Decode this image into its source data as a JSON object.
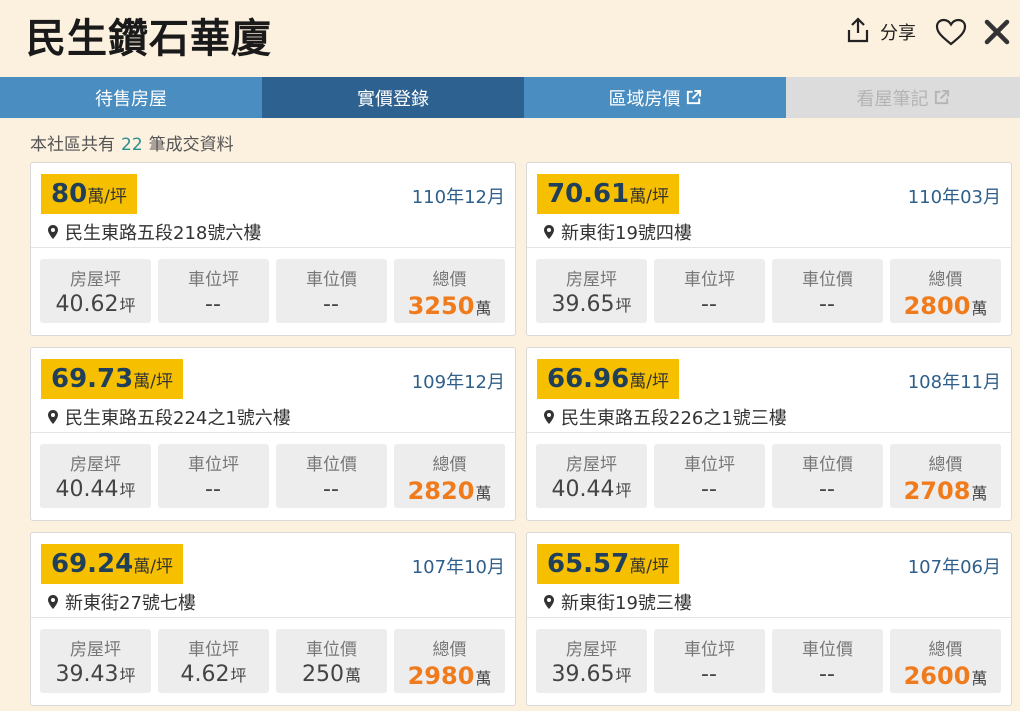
{
  "header": {
    "title": "民生鑽石華廈",
    "share_label": "分享"
  },
  "tabs": [
    {
      "label": "待售房屋",
      "active": false,
      "disabled": false
    },
    {
      "label": "實價登錄",
      "active": true,
      "disabled": false
    },
    {
      "label": "區域房價",
      "active": false,
      "disabled": false
    },
    {
      "label": "看屋筆記",
      "active": false,
      "disabled": true
    }
  ],
  "summary": {
    "prefix": "本社區共有",
    "count": "22",
    "suffix": "筆成交資料"
  },
  "labels": {
    "price_unit": "萬/坪",
    "area": "房屋坪",
    "parking_area": "車位坪",
    "parking_price": "車位價",
    "total": "總價",
    "ping": "坪",
    "wan": "萬"
  },
  "colors": {
    "badge": "#f6c000",
    "tab": "#4a8dc0",
    "tab_active": "#2d6290",
    "total": "#f07b1c",
    "date": "#2f5f8a",
    "background": "#fcf0df"
  },
  "records": [
    {
      "price": "80",
      "date": "110年12月",
      "address": "民生東路五段218號六樓",
      "area": "40.62",
      "parking_area": "--",
      "parking_price": "--",
      "total": "3250"
    },
    {
      "price": "70.61",
      "date": "110年03月",
      "address": "新東街19號四樓",
      "area": "39.65",
      "parking_area": "--",
      "parking_price": "--",
      "total": "2800"
    },
    {
      "price": "69.73",
      "date": "109年12月",
      "address": "民生東路五段224之1號六樓",
      "area": "40.44",
      "parking_area": "--",
      "parking_price": "--",
      "total": "2820"
    },
    {
      "price": "66.96",
      "date": "108年11月",
      "address": "民生東路五段226之1號三樓",
      "area": "40.44",
      "parking_area": "--",
      "parking_price": "--",
      "total": "2708"
    },
    {
      "price": "69.24",
      "date": "107年10月",
      "address": "新東街27號七樓",
      "area": "39.43",
      "parking_area": "4.62",
      "parking_price": "250",
      "total": "2980"
    },
    {
      "price": "65.57",
      "date": "107年06月",
      "address": "新東街19號三樓",
      "area": "39.65",
      "parking_area": "--",
      "parking_price": "--",
      "total": "2600"
    }
  ]
}
